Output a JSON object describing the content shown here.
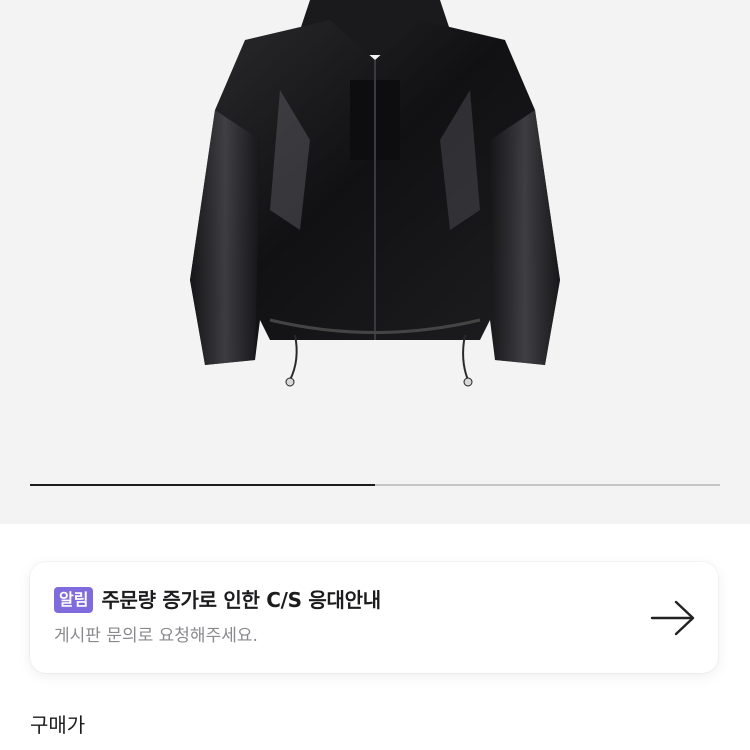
{
  "product": {
    "image_icon": "black-nylon-windbreaker-jacket",
    "image_bg": "#f3f3f4",
    "carousel_progress": 0.5
  },
  "notice": {
    "badge": "알림",
    "title": "주문량 증가로 인한 C/S 응대안내",
    "subtitle": "게시판 문의로 요청해주세요.",
    "arrow_icon": "arrow-right-icon",
    "badge_color": "#7f6bdc"
  },
  "price": {
    "label": "구매가"
  }
}
